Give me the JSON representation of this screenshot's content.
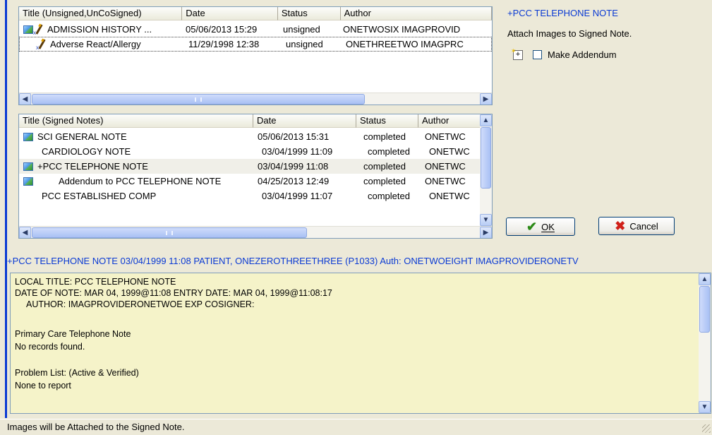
{
  "unsigned_list": {
    "columns": [
      "Title (Unsigned,UnCoSigned)",
      "Date",
      "Status",
      "Author"
    ],
    "rows": [
      {
        "title": "ADMISSION HISTORY ...",
        "date": "05/06/2013 15:29",
        "status": "unsigned",
        "author": "ONETWOSIX IMAGPROVID"
      },
      {
        "title": "Adverse React/Allergy",
        "date": "11/29/1998 12:38",
        "status": "unsigned",
        "author": "ONETHREETWO IMAGPRC"
      }
    ]
  },
  "signed_list": {
    "columns": [
      "Title (Signed Notes)",
      "Date",
      "Status",
      "Author"
    ],
    "rows": [
      {
        "title": "SCI GENERAL NOTE",
        "date": "05/06/2013 15:31",
        "status": "completed",
        "author": "ONETWC"
      },
      {
        "title": "CARDIOLOGY NOTE",
        "date": "03/04/1999 11:09",
        "status": "completed",
        "author": "ONETWC"
      },
      {
        "title": "+PCC TELEPHONE NOTE",
        "date": "03/04/1999 11:08",
        "status": "completed",
        "author": "ONETWC"
      },
      {
        "title": "Addendum to PCC TELEPHONE NOTE",
        "date": "04/25/2013 12:49",
        "status": "completed",
        "author": "ONETWC"
      },
      {
        "title": "PCC ESTABLISHED COMP",
        "date": "03/04/1999 11:07",
        "status": "completed",
        "author": "ONETWC"
      }
    ]
  },
  "right_panel": {
    "title": "+PCC TELEPHONE NOTE",
    "attach_text": "Attach Images to Signed Note.",
    "make_addendum_label": "Make Addendum",
    "make_addendum_checked": false
  },
  "buttons": {
    "ok": "OK",
    "cancel": "Cancel"
  },
  "info_line": "+PCC TELEPHONE NOTE  03/04/1999 11:08  PATIENT, ONEZEROTHREETHREE  (P1033)  Auth: ONETWOEIGHT IMAGPROVIDERONETV",
  "note_text": {
    "l1": "LOCAL TITLE: PCC TELEPHONE NOTE",
    "l2": "DATE OF NOTE: MAR 04, 1999@11:08     ENTRY DATE: MAR 04, 1999@11:08:17",
    "l3": "AUTHOR: IMAGPROVIDERONETWOE  EXP COSIGNER:",
    "l4": "Primary Care Telephone Note",
    "l5": "No records found.",
    "l6": "Problem List: (Active & Verified)",
    "l7": "None to report"
  },
  "status_bar": "Images will be Attached to the Signed Note.",
  "icons": {
    "image": "image-icon",
    "sign": "sign-pen-icon",
    "ok": "checkmark-icon",
    "cancel": "x-icon",
    "new_addendum": "new-addendum-icon"
  }
}
